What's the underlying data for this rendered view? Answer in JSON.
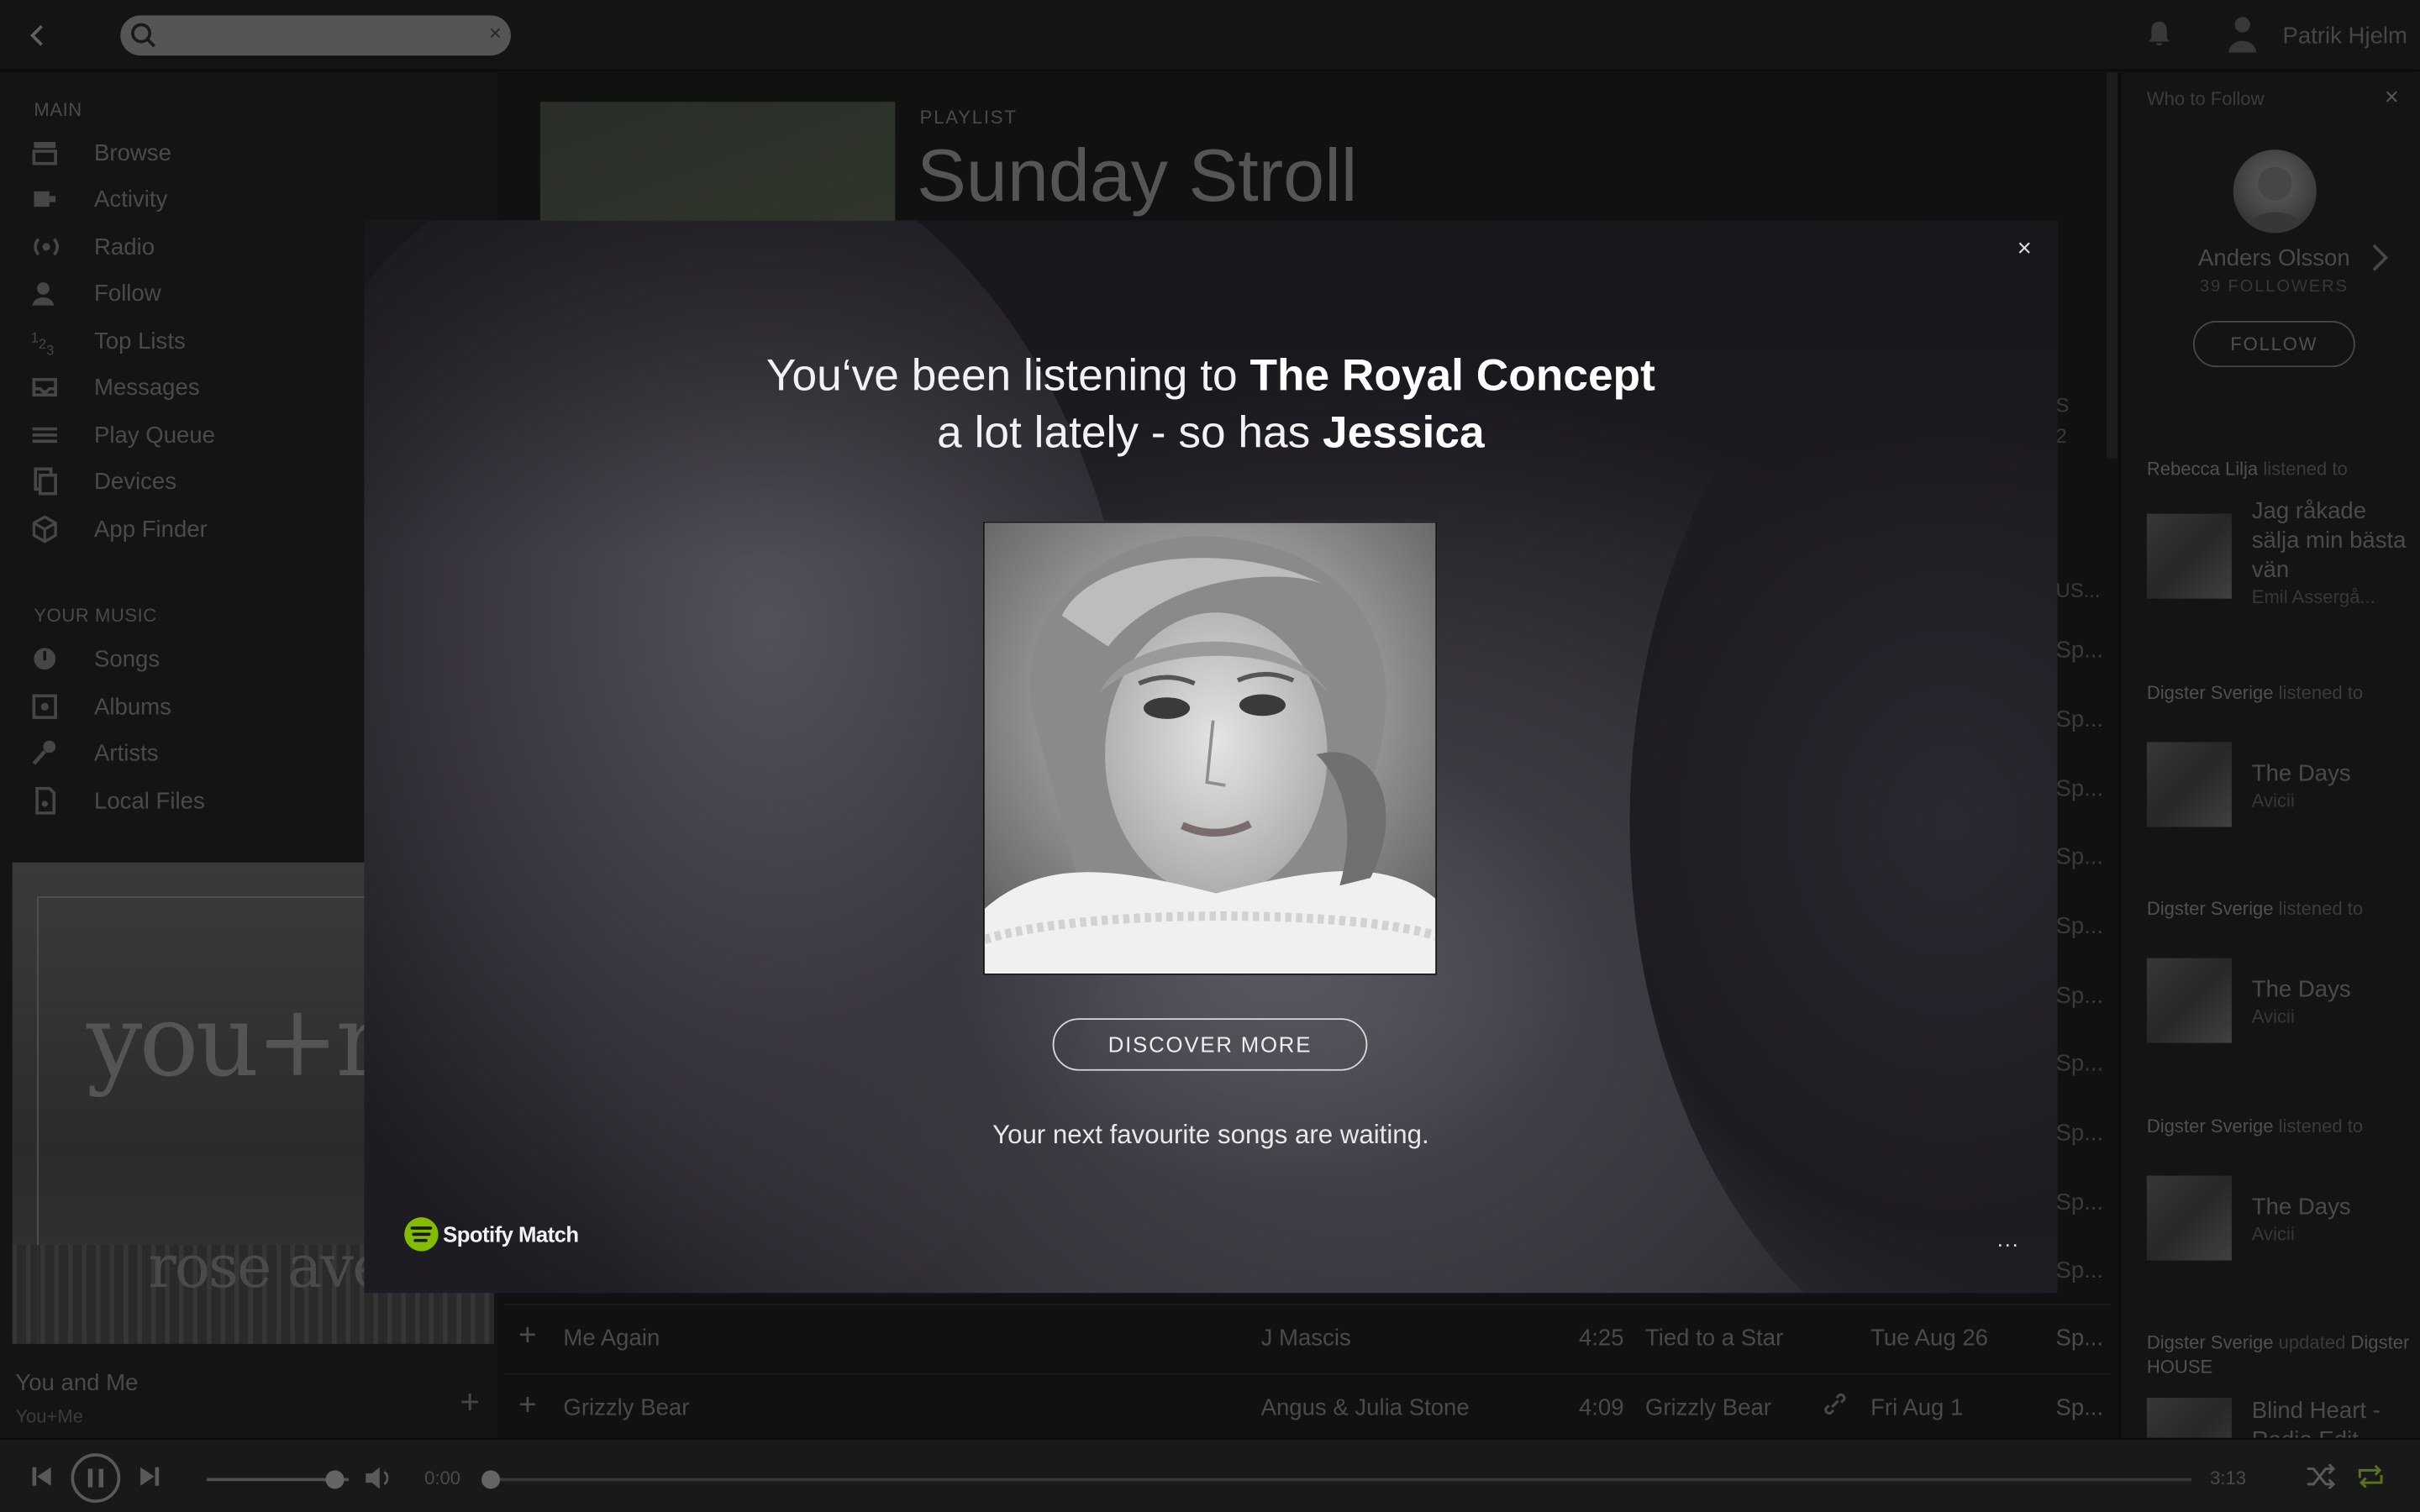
{
  "topbar": {
    "search": {
      "value": "",
      "placeholder": ""
    },
    "user_name": "Patrik Hjelm"
  },
  "sidebar": {
    "main_title": "MAIN",
    "main_items": [
      {
        "label": "Browse",
        "icon": "browse-icon"
      },
      {
        "label": "Activity",
        "icon": "activity-icon"
      },
      {
        "label": "Radio",
        "icon": "radio-icon"
      },
      {
        "label": "Follow",
        "icon": "follow-icon"
      },
      {
        "label": "Top Lists",
        "icon": "top-lists-icon"
      },
      {
        "label": "Messages",
        "icon": "messages-icon"
      },
      {
        "label": "Play Queue",
        "icon": "play-queue-icon"
      },
      {
        "label": "Devices",
        "icon": "devices-icon"
      },
      {
        "label": "App Finder",
        "icon": "app-finder-icon"
      }
    ],
    "your_music_title": "YOUR MUSIC",
    "music_items": [
      {
        "label": "Songs",
        "icon": "songs-icon"
      },
      {
        "label": "Albums",
        "icon": "albums-icon"
      },
      {
        "label": "Artists",
        "icon": "artists-icon"
      },
      {
        "label": "Local Files",
        "icon": "local-files-icon"
      }
    ],
    "now_playing": {
      "title": "You and Me",
      "artist": "You+Me",
      "cover_text_1": "you+m",
      "cover_text_2": "rose ave."
    }
  },
  "main": {
    "playlist_type": "PLAYLIST",
    "playlist_title": "Sunday Stroll",
    "header_fragments": [
      "S",
      "2",
      "US..."
    ],
    "partial_rows": [
      "Sp...",
      "Sp...",
      "Sp...",
      "Sp...",
      "Sp...",
      "Sp...",
      "Sp...",
      "Sp...",
      "Sp...",
      "Sp..."
    ],
    "rows": [
      {
        "title": "Me Again",
        "artist": "J Mascis",
        "duration": "4:25",
        "album": "Tied to a Star",
        "added": "Tue Aug 26",
        "user": "Sp..."
      },
      {
        "title": "Grizzly Bear",
        "artist": "Angus & Julia Stone",
        "duration": "4:09",
        "album": "Grizzly Bear",
        "added": "Fri Aug 1",
        "user": "Sp..."
      }
    ]
  },
  "right_panel": {
    "title": "Who to Follow",
    "suggested": {
      "name": "Anders Olsson",
      "followers": "39 FOLLOWERS",
      "follow_label": "FOLLOW"
    },
    "feed": [
      {
        "user": "Rebecca Lilja",
        "action": "listened to",
        "title": "Jag råkade sälja min bästa vän",
        "subtitle": "Emil Assergå..."
      },
      {
        "user": "Digster Sverige",
        "action": "listened to",
        "title": "The Days",
        "subtitle": "Avicii"
      },
      {
        "user": "Digster Sverige",
        "action": "listened to",
        "title": "The Days",
        "subtitle": "Avicii"
      },
      {
        "user": "Digster Sverige",
        "action": "listened to",
        "title": "The Days",
        "subtitle": "Avicii"
      },
      {
        "user": "Digster Sverige",
        "action": "updated",
        "target": "Digster HOUSE",
        "title": "Blind Heart - Radio Edit"
      }
    ]
  },
  "player": {
    "current_time": "0:00",
    "total_time": "3:13",
    "progress": 0,
    "volume": 0.9
  },
  "modal": {
    "line1_prefix": "You‘ve been listening to ",
    "artist": "The Royal Concept",
    "line2_prefix": "a lot lately - so has ",
    "friend": "Jessica",
    "button_label": "DISCOVER MORE",
    "tagline": "Your next favourite songs are waiting.",
    "brand": "Spotify Match",
    "more": "...",
    "close": "×"
  },
  "colors": {
    "spotify_green": "#84bd00"
  }
}
